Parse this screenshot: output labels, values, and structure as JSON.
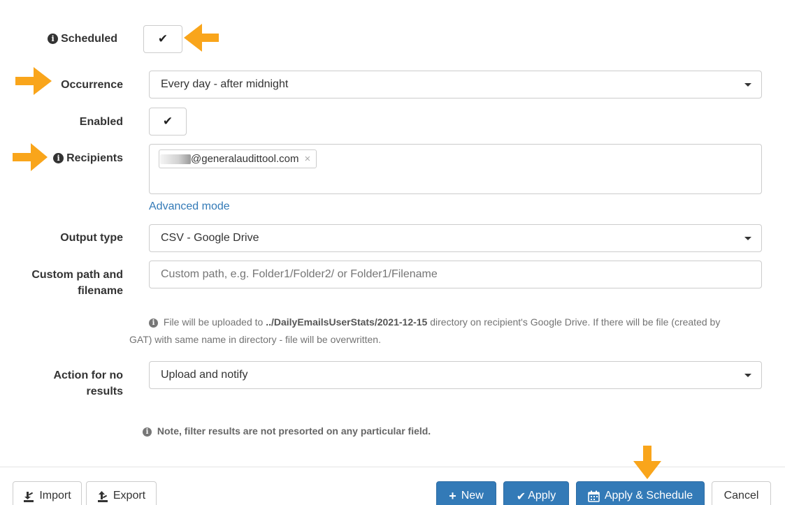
{
  "form": {
    "scheduled": {
      "label": "Scheduled",
      "checked_glyph": "✔"
    },
    "occurrence": {
      "label": "Occurrence",
      "value": "Every day - after midnight"
    },
    "enabled": {
      "label": "Enabled",
      "checked_glyph": "✔"
    },
    "recipients": {
      "label": "Recipients",
      "tags": [
        {
          "email_visible": "@generalaudittool.com",
          "remove": "×"
        }
      ],
      "advanced_link": "Advanced mode"
    },
    "output_type": {
      "label": "Output type",
      "value": "CSV - Google Drive"
    },
    "custom_path": {
      "label_line1": "Custom path and",
      "label_line2": "filename",
      "placeholder": "Custom path, e.g. Folder1/Folder2/ or Folder1/Filename"
    },
    "upload_info": {
      "prefix": "File will be uploaded to",
      "path": "../DailyEmailsUserStats/2021-12-15",
      "suffix_line1": "directory on recipient's Google Drive. If there will be file (created by",
      "line2": "GAT) with same name in directory - file will be overwritten."
    },
    "no_results_action": {
      "label_line1": "Action for no",
      "label_line2": "results",
      "value": "Upload and notify"
    },
    "note": "Note, filter results are not presorted on any particular field."
  },
  "footer": {
    "import_label": "Import",
    "export_label": "Export",
    "new_label": "New",
    "apply_label": "Apply",
    "apply_schedule_label": "Apply & Schedule",
    "cancel_label": "Cancel"
  },
  "icons": {
    "info": "info-circle-icon",
    "check": "check-icon",
    "dropdown": "caret-down-icon",
    "plus": "plus-icon",
    "calendar": "calendar-icon",
    "import": "import-icon",
    "export": "export-icon"
  },
  "colors": {
    "primary": "#337ab7",
    "link": "#337ab7",
    "annotation_arrow": "#f9a51b"
  }
}
